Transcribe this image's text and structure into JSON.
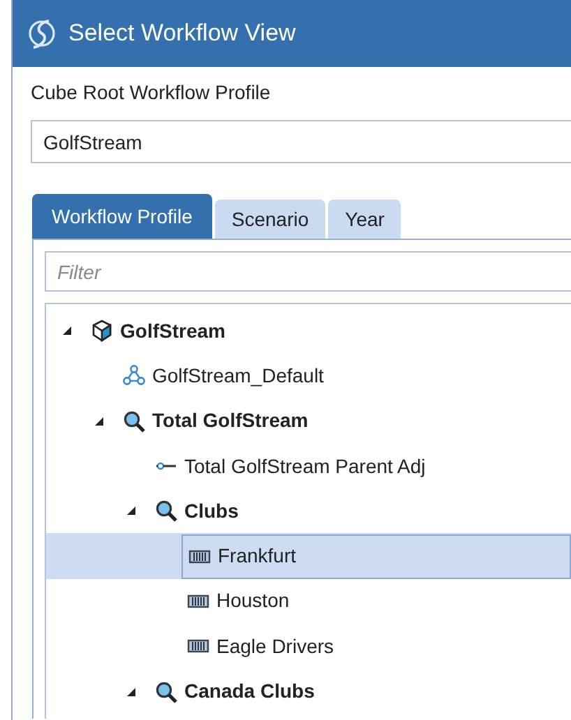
{
  "window": {
    "title": "Select Workflow View"
  },
  "root_profile": {
    "label": "Cube Root Workflow Profile",
    "value": "GolfStream"
  },
  "tabs": [
    {
      "label": "Workflow Profile",
      "selected": true
    },
    {
      "label": "Scenario",
      "selected": false
    },
    {
      "label": "Year",
      "selected": false
    }
  ],
  "filter": {
    "placeholder": "Filter"
  },
  "tree": [
    {
      "label": "GolfStream",
      "kind": "cube",
      "expanded": true,
      "selected": false,
      "children": [
        {
          "label": "GolfStream_Default",
          "kind": "workflow",
          "selected": false
        },
        {
          "label": "Total GolfStream",
          "kind": "group",
          "expanded": true,
          "selected": false,
          "children": [
            {
              "label": "Total GolfStream Parent Adj",
              "kind": "adjustment",
              "selected": false
            },
            {
              "label": "Clubs",
              "kind": "group",
              "expanded": true,
              "selected": false,
              "children": [
                {
                  "label": "Frankfurt",
                  "kind": "entity",
                  "selected": true
                },
                {
                  "label": "Houston",
                  "kind": "entity",
                  "selected": false
                },
                {
                  "label": "Eagle Drivers",
                  "kind": "entity",
                  "selected": false
                }
              ]
            },
            {
              "label": "Canada Clubs",
              "kind": "group",
              "expanded": true,
              "selected": false
            }
          ]
        }
      ]
    }
  ]
}
